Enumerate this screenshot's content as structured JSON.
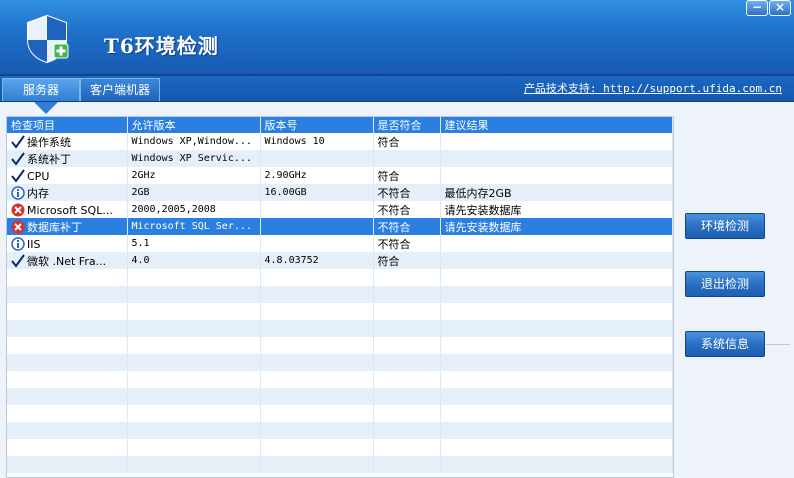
{
  "app": {
    "title": "T6环境检测",
    "minimize_glyph": "−",
    "close_glyph": "×"
  },
  "tabs": [
    {
      "label": "服务器"
    },
    {
      "label": "客户端机器"
    }
  ],
  "support_text": "产品技术支持: http://support.ufida.com.cn",
  "table": {
    "columns": [
      "检查项目",
      "允许版本",
      "版本号",
      "是否符合",
      "建议结果"
    ],
    "rows": [
      {
        "icon": "check-icon",
        "item": "操作系统",
        "allowed": "Windows XP,Window...",
        "version": "Windows 10",
        "match": "符合",
        "advice": ""
      },
      {
        "icon": "check-icon",
        "item": "系统补丁",
        "allowed": "Windows XP Servic...",
        "version": "",
        "match": "",
        "advice": ""
      },
      {
        "icon": "check-icon",
        "item": "CPU",
        "allowed": "2GHz",
        "version": "2.90GHz",
        "match": "符合",
        "advice": ""
      },
      {
        "icon": "info-icon",
        "item": "内存",
        "allowed": "2GB",
        "version": "16.00GB",
        "match": "不符合",
        "advice": "最低内存2GB"
      },
      {
        "icon": "error-icon",
        "item": "Microsoft SQL...",
        "allowed": "2000,2005,2008",
        "version": "",
        "match": "不符合",
        "advice": "请先安装数据库"
      },
      {
        "icon": "error-icon",
        "item": "数据库补丁",
        "allowed": "Microsoft SQL Ser...",
        "version": "",
        "match": "不符合",
        "advice": "请先安装数据库",
        "selected": true
      },
      {
        "icon": "info-icon",
        "item": "IIS",
        "allowed": "5.1",
        "version": "",
        "match": "不符合",
        "advice": ""
      },
      {
        "icon": "check-icon",
        "item": "微软 .Net Fra...",
        "allowed": "4.0",
        "version": "4.8.03752",
        "match": "符合",
        "advice": ""
      }
    ]
  },
  "buttons": {
    "env_check": "环境检测",
    "exit_check": "退出检测",
    "system_info": "系统信息"
  },
  "colors": {
    "header_blue": "#1e6fc9",
    "selection_blue": "#2a7fe0",
    "stripe": "#e5effa"
  }
}
